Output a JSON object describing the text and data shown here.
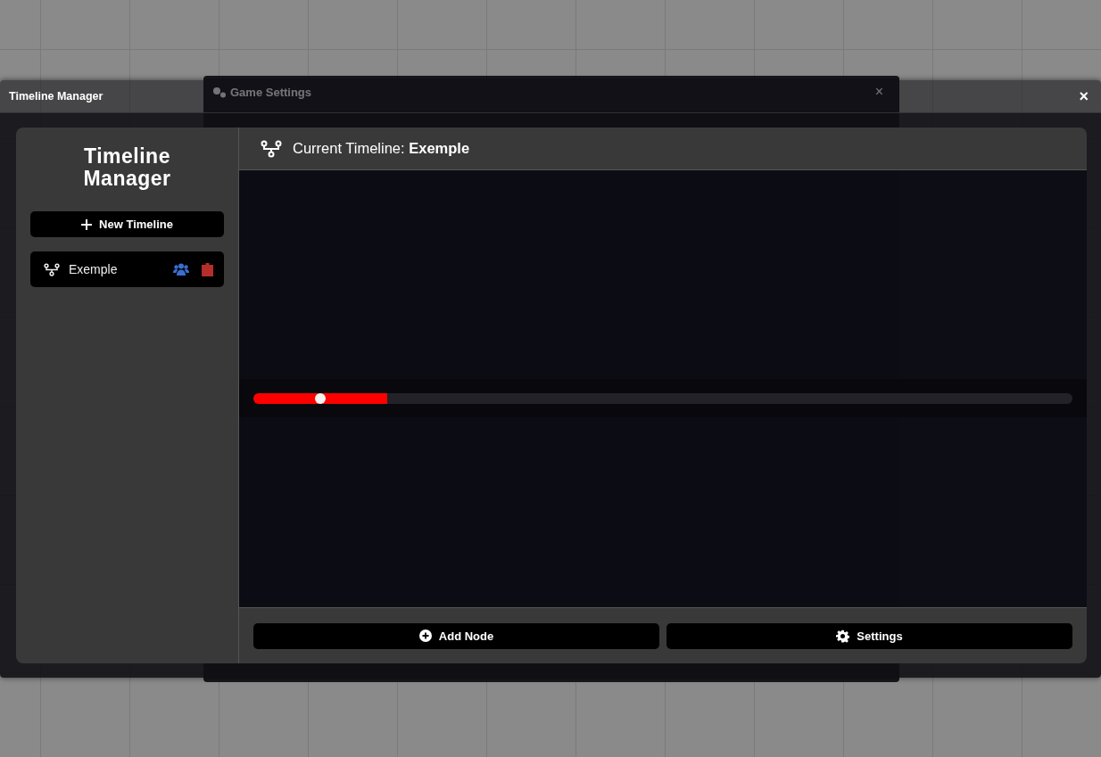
{
  "background_window": {
    "title": "Game Settings",
    "close": "×"
  },
  "window": {
    "title": "Timeline Manager",
    "close": "×"
  },
  "sidebar": {
    "title": "Timeline Manager",
    "new_button": "New Timeline",
    "items": [
      {
        "label": "Exemple"
      }
    ]
  },
  "header": {
    "text": "Current Timeline: **Exemple**"
  },
  "timeline": {
    "progress": {
      "level": 0.163
    },
    "playhead": {
      "level": 0.082
    }
  },
  "footer": {
    "buttons": [
      {
        "kind": "add",
        "label": "Add Node"
      },
      {
        "kind": "settings",
        "label": "Settings"
      }
    ]
  }
}
